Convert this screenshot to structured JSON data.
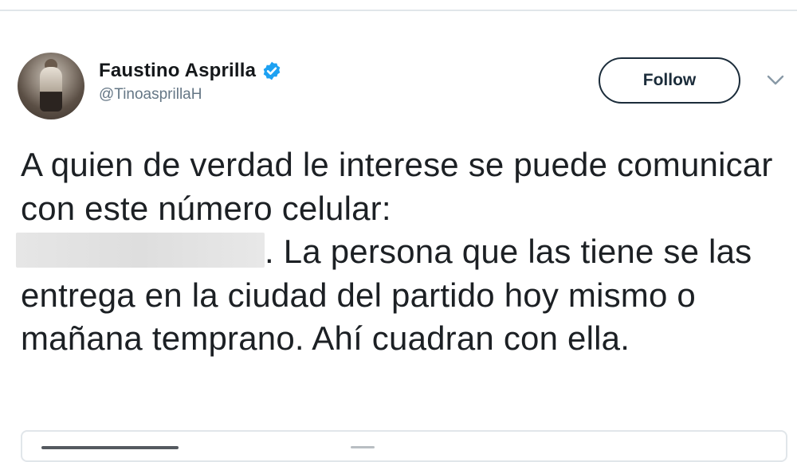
{
  "tweet": {
    "author": {
      "display_name": "Faustino Asprilla",
      "handle": "@TinoasprillaH",
      "verified": true,
      "avatar_icon": "profile-photo"
    },
    "follow_label": "Follow",
    "menu_icon": "chevron-down-icon",
    "text_part1": "A quien de verdad le interese se puede comunicar con este número celular:",
    "text_part2": ". La persona que las tiene se las entrega en la ciudad del partido hoy mismo o mañana temprano. Ahí cuadran con ella."
  },
  "colors": {
    "verified_badge": "#1da1f2",
    "handle_text": "#657786",
    "follow_border": "#1b2c3a"
  }
}
